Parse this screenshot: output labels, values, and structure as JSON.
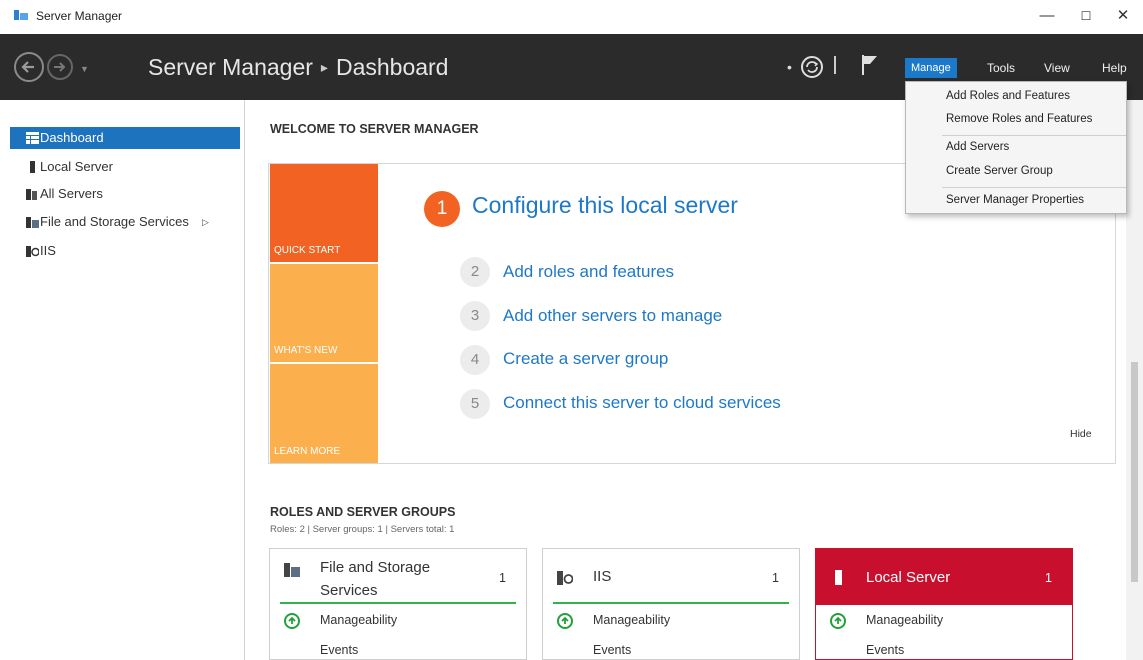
{
  "window": {
    "title": "Server Manager",
    "minimize": "—",
    "maximize": "☐",
    "close": "✕"
  },
  "header": {
    "app_name": "Server Manager",
    "page": "Dashboard",
    "menus": [
      "Manage",
      "Tools",
      "View",
      "Help"
    ]
  },
  "manage_menu": {
    "items": [
      "Add Roles and Features",
      "Remove Roles and Features",
      "Add Servers",
      "Create Server Group",
      "Server Manager Properties"
    ]
  },
  "sidebar": {
    "items": [
      {
        "label": "Dashboard",
        "icon": "dashboard-icon"
      },
      {
        "label": "Local Server",
        "icon": "server-icon"
      },
      {
        "label": "All Servers",
        "icon": "servers-icon"
      },
      {
        "label": "File and Storage Services",
        "icon": "storage-icon"
      },
      {
        "label": "IIS",
        "icon": "iis-icon"
      }
    ]
  },
  "welcome": {
    "title": "WELCOME TO SERVER MANAGER",
    "tiles": [
      "QUICK START",
      "WHAT'S NEW",
      "LEARN MORE"
    ],
    "step1": {
      "num": "1",
      "label": "Configure this local server"
    },
    "steps": [
      {
        "num": "2",
        "label": "Add roles and features"
      },
      {
        "num": "3",
        "label": "Add other servers to manage"
      },
      {
        "num": "4",
        "label": "Create a server group"
      },
      {
        "num": "5",
        "label": "Connect this server to cloud services"
      }
    ],
    "hide": "Hide"
  },
  "roles": {
    "title": "ROLES AND SERVER GROUPS",
    "subtitle": "Roles: 2  |  Server groups: 1  |  Servers total: 1",
    "cards": [
      {
        "title_line1": "File and Storage",
        "title_line2": "Services",
        "count": "1",
        "row1": "Manageability",
        "row2": "Events"
      },
      {
        "title": "IIS",
        "count": "1",
        "row1": "Manageability",
        "row2": "Events"
      },
      {
        "title": "Local Server",
        "count": "1",
        "row1": "Manageability",
        "row2": "Events"
      }
    ]
  },
  "colors": {
    "accent": "#1e73be",
    "quick_start": "#f26222",
    "tile": "#fcb04d",
    "local_server": "#c8102e",
    "healthy": "#2fb34a"
  }
}
